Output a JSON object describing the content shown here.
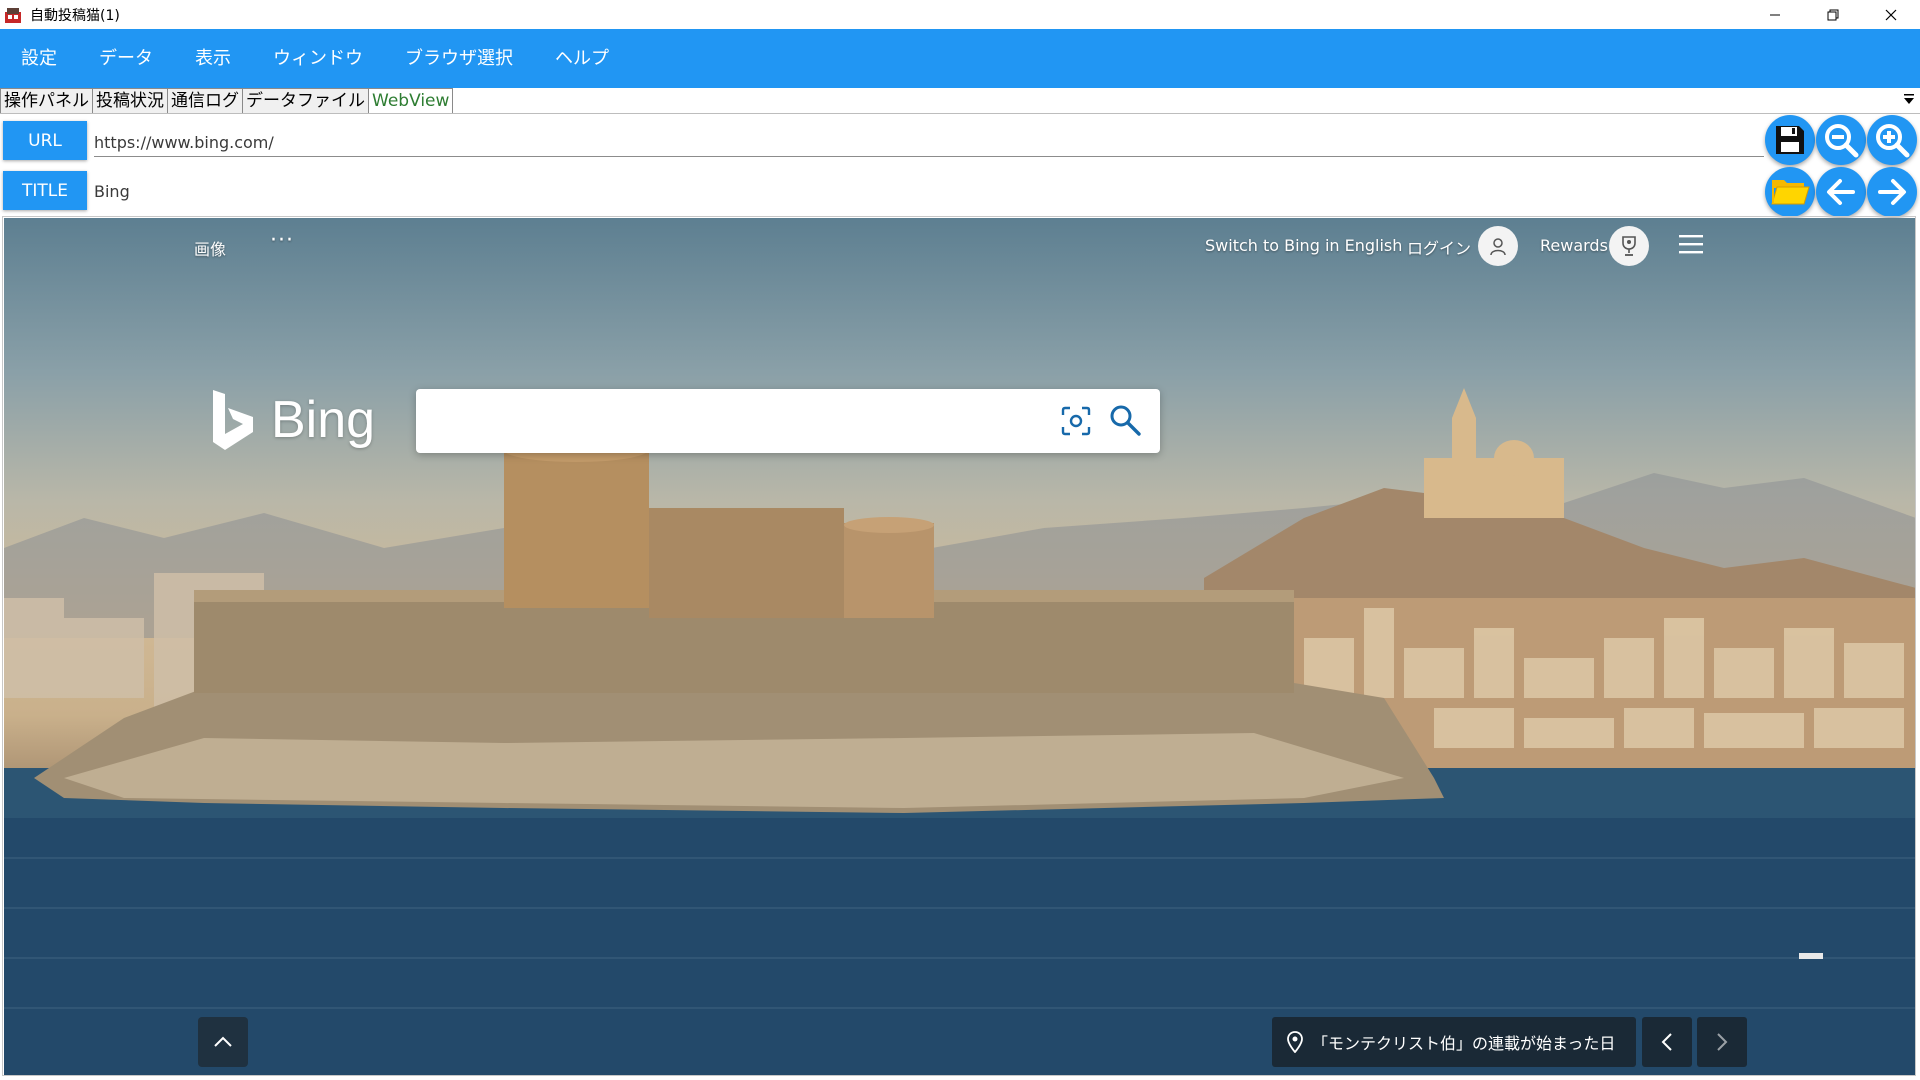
{
  "window": {
    "title": "自動投稿猫(1)",
    "controls": [
      "minimize-icon",
      "restore-icon",
      "close-icon"
    ]
  },
  "menu": {
    "items": [
      "設定",
      "データ",
      "表示",
      "ウィンドウ",
      "ブラウザ選択",
      "ヘルプ"
    ]
  },
  "tabs": {
    "items": [
      "操作パネル",
      "投稿状況",
      "通信ログ",
      "データファイル",
      "WebView"
    ],
    "active": "WebView"
  },
  "address": {
    "url_label": "URL",
    "url_value": "https://www.bing.com/",
    "title_label": "TITLE",
    "title_value": "Bing"
  },
  "toolbar": {
    "icons": [
      "save-icon",
      "zoom-out-icon",
      "zoom-in-icon",
      "folder-open-icon",
      "back-arrow-icon",
      "forward-arrow-icon"
    ]
  },
  "bing": {
    "images": "画像",
    "more": "···",
    "switch_language": "Switch to Bing in English",
    "login": "ログイン",
    "rewards": "Rewards",
    "logo_text": "Bing",
    "search_placeholder": "",
    "caption": "「モンテクリスト伯」の連載が始まった日"
  },
  "colors": {
    "accent": "#2196f3",
    "active_tab_text": "#2e7d32",
    "folder_yellow": "#ffd500"
  }
}
